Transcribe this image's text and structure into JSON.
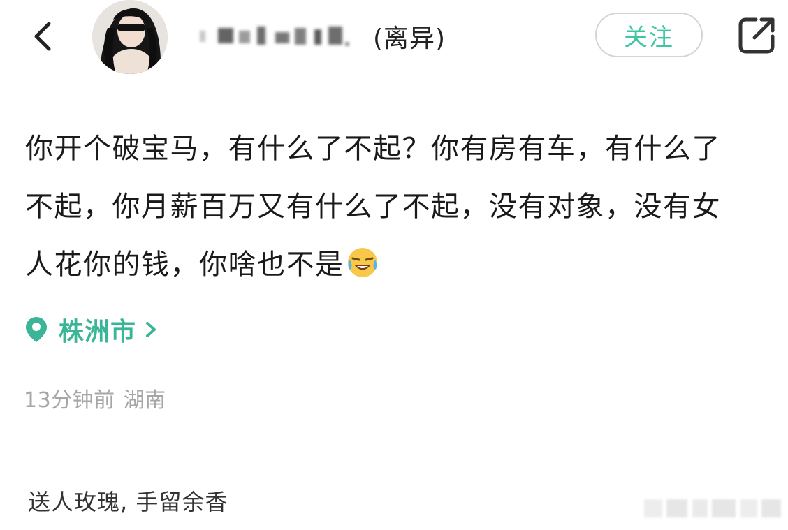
{
  "header": {
    "back_icon": "chevron-left-icon",
    "avatar": "user-avatar",
    "username_tag": "(离异)",
    "follow_label": "关注",
    "share_icon": "external-share-icon"
  },
  "post": {
    "lines": [
      "你开个破宝马，有什么了不起？你有房有车，有什么了",
      "不起，你月薪百万又有什么了不起，没有对象，没有女",
      "人花你的钱，你啥也不是"
    ],
    "emoji": "laughing-crying-emoji"
  },
  "location": {
    "icon": "location-pin-icon",
    "label": "株洲市",
    "chevron": "chevron-right-icon"
  },
  "meta": {
    "time": "13分钟前",
    "region": "湖南"
  },
  "footer": {
    "text": "送人玫瑰, 手留余香"
  },
  "colors": {
    "accent": "#3ec6a3",
    "location": "#3ab597",
    "meta_gray": "#a6a6a6",
    "text": "#1a1a1a"
  }
}
